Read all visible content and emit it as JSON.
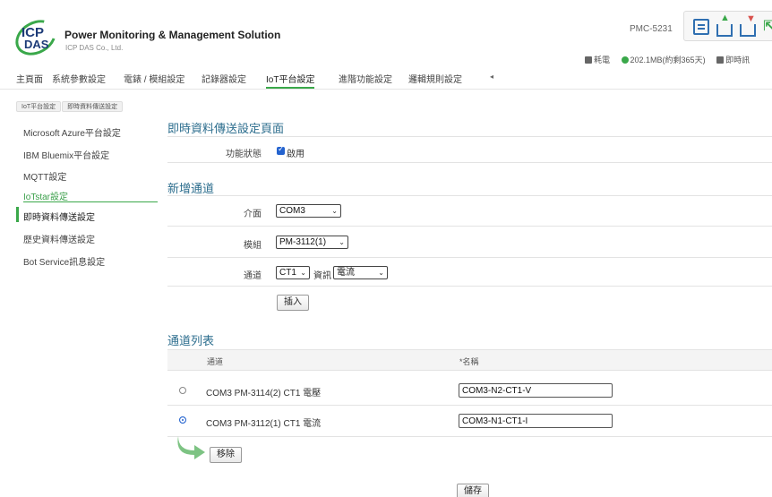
{
  "header": {
    "logo_top": "ICP",
    "logo_bottom": "DAS",
    "title": "Power Monitoring & Management Solution",
    "company": "ICP DAS Co., Ltd.",
    "model": "PMC-5231",
    "status": {
      "item1": "耗電",
      "item2": "202.1MB(約剩365天)",
      "item3": "即時訊"
    }
  },
  "nav": {
    "items": [
      "主頁面",
      "系統參數設定",
      "電錶 / 模組設定",
      "記錄器設定",
      "IoT平台設定",
      "進階功能設定",
      "邏輯規則設定"
    ],
    "active_index": 4,
    "arrow": "◂"
  },
  "breadcrumb": [
    "IoT平台設定",
    "即時資料傳送設定"
  ],
  "sidebar": {
    "items": [
      "Microsoft Azure平台設定",
      "IBM Bluemix平台設定",
      "MQTT設定",
      "IoTstar設定",
      "即時資料傳送設定",
      "歷史資料傳送設定",
      "Bot Service訊息設定"
    ],
    "group_index": 3,
    "active_index": 4
  },
  "main": {
    "page_title": "即時資料傳送設定頁面",
    "function_status": {
      "label": "功能狀態",
      "checkbox_label": "啟用",
      "checked": true
    },
    "add_channel": {
      "title": "新增通道",
      "interface_label": "介面",
      "interface_value": "COM3",
      "module_label": "模組",
      "module_value": "PM-3112(1)",
      "channel_label": "通道",
      "channel_value": "CT1",
      "data_label": "資訊",
      "data_value": "電流",
      "insert_button": "插入"
    },
    "channel_list": {
      "title": "通道列表",
      "col_channel": "通道",
      "col_name": "*名稱",
      "rows": [
        {
          "channel": "COM3 PM-3114(2) CT1 電壓",
          "name": "COM3-N2-CT1-V",
          "selected": false
        },
        {
          "channel": "COM3 PM-3112(1) CT1 電流",
          "name": "COM3-N1-CT1-I",
          "selected": true
        }
      ],
      "remove_button": "移除"
    },
    "save_button": "儲存"
  },
  "colors": {
    "accent": "#3aa84a",
    "title_blue": "#2d6e8e",
    "check_blue": "#2463cf"
  }
}
